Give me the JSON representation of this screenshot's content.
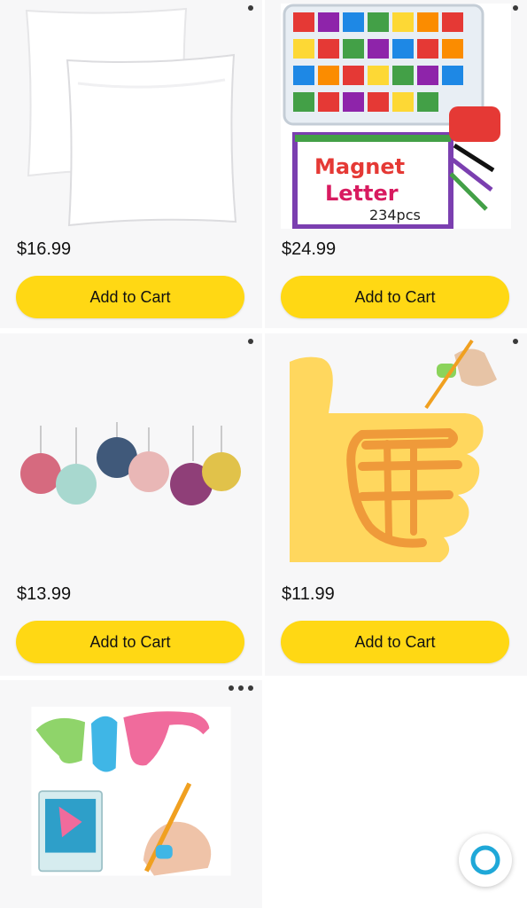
{
  "products": [
    {
      "price": "$16.99",
      "add_label": "Add to Cart",
      "image": "white-pillows-image"
    },
    {
      "price": "$24.99",
      "add_label": "Add to Cart",
      "image": "magnet-letters-image"
    },
    {
      "price": "$13.99",
      "add_label": "Add to Cart",
      "image": "paper-lanterns-image"
    },
    {
      "price": "$11.99",
      "add_label": "Add to Cart",
      "image": "pencil-grip-image"
    },
    {
      "price": "",
      "add_label": "",
      "image": "pencil-grips-pack-image"
    }
  ],
  "overlay": {
    "emoji": "thumbs-up-emoji"
  },
  "magnet_box": {
    "line1": "Magnet",
    "line2": "Letter",
    "line3": "234pcs"
  },
  "assistant": {
    "icon": "alexa-icon"
  },
  "colors": {
    "button": "#ffd814",
    "card_bg": "#f7f7f8",
    "alexa_ring": "#1fa8d8"
  }
}
